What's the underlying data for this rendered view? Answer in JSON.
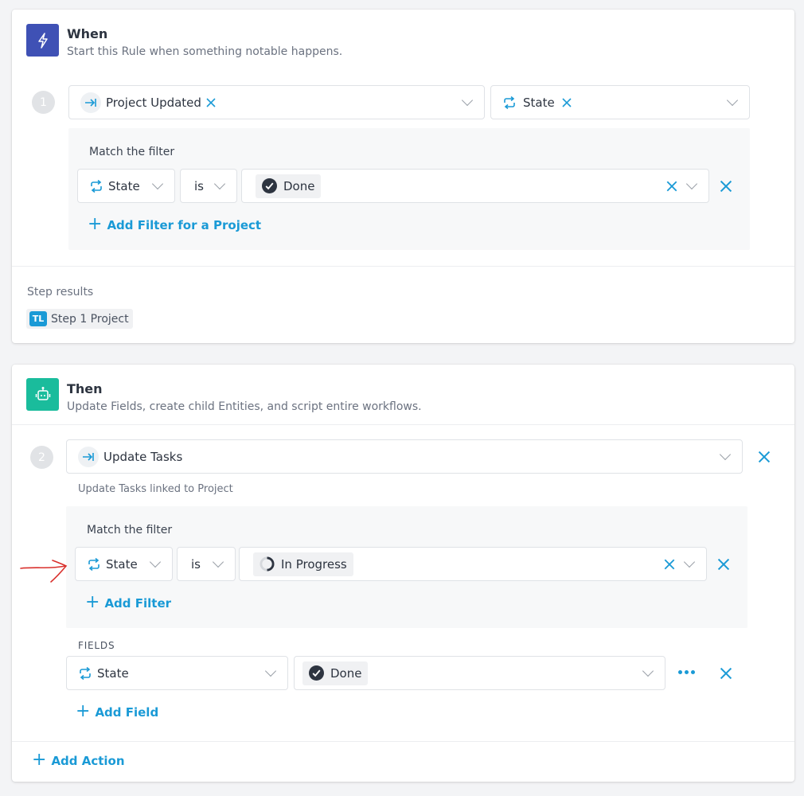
{
  "when": {
    "title": "When",
    "subtitle": "Start this Rule when something notable happens.",
    "icon": "lightning-icon",
    "icon_color": "#3f51b5",
    "step_number": "1",
    "trigger": {
      "label": "Project Updated",
      "icon": "arrow-to-right-icon"
    },
    "field": {
      "label": "State",
      "icon": "repeat-icon"
    },
    "filter": {
      "heading": "Match the filter",
      "field": "State",
      "operator": "is",
      "value": "Done",
      "value_icon": "check-circle-icon",
      "add_label": "Add Filter for a Project"
    },
    "step_results": {
      "heading": "Step results",
      "badge": "TL",
      "item": "Step 1 Project"
    }
  },
  "then": {
    "title": "Then",
    "subtitle": "Update Fields, create child Entities, and script entire workflows.",
    "icon": "robot-icon",
    "icon_color": "#1abc9c",
    "step_number": "2",
    "action": {
      "label": "Update Tasks",
      "icon": "arrow-to-right-icon"
    },
    "action_hint": "Update Tasks linked to Project",
    "filter": {
      "heading": "Match the filter",
      "field": "State",
      "operator": "is",
      "value": "In Progress",
      "value_icon": "half-circle-icon",
      "add_label": "Add Filter"
    },
    "fields": {
      "heading": "FIELDS",
      "field": "State",
      "value": "Done",
      "value_icon": "check-circle-icon",
      "add_label": "Add Field"
    },
    "add_action_label": "Add Action"
  },
  "colors": {
    "accent": "#1a9ad6",
    "annotation_arrow": "#d9302c"
  }
}
